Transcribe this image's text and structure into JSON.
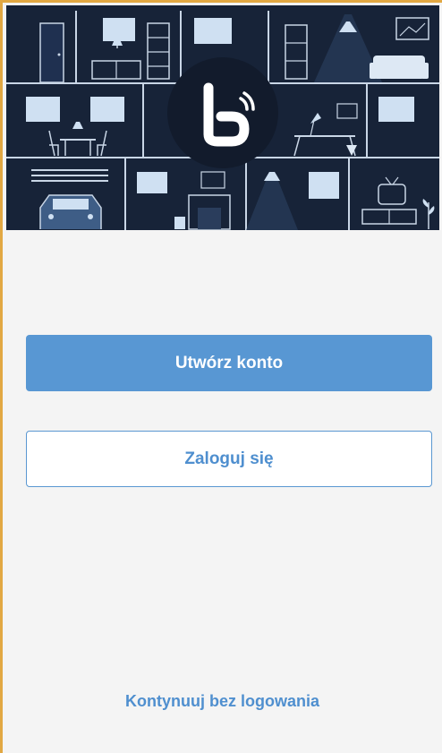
{
  "hero": {
    "logo": "brand-logo-icon"
  },
  "actions": {
    "create_account_label": "Utwórz konto",
    "login_label": "Zaloguj się",
    "skip_label": "Kontynuuj bez logowania"
  },
  "colors": {
    "primary": "#5897d3",
    "link": "#4f8fcf",
    "hero_bg": "#172338",
    "background": "#f4f4f4",
    "accent_border": "#e2a843"
  }
}
